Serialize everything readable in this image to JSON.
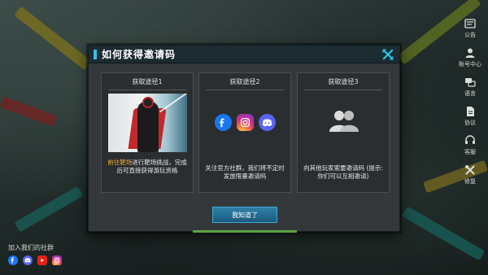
{
  "dialog": {
    "title": "如何获得邀请码",
    "ok_label": "我知道了",
    "cards": [
      {
        "title": "获取途径1",
        "highlight": "前往靶场",
        "text": "进行靶场挑战，完成后可直接获得游玩资格"
      },
      {
        "title": "获取途径2",
        "text": "关注官方社群，我们将不定时发放限量邀请码",
        "icons": [
          "facebook-icon",
          "instagram-icon",
          "discord-icon"
        ]
      },
      {
        "title": "获取途径3",
        "text": "向其他玩家索要邀请码 (提示:你们可以互相邀请)"
      }
    ]
  },
  "side_menu": [
    {
      "label": "公告",
      "icon": "announcement-icon"
    },
    {
      "label": "账号中心",
      "icon": "account-icon"
    },
    {
      "label": "语言",
      "icon": "language-icon"
    },
    {
      "label": "协议",
      "icon": "agreement-icon"
    },
    {
      "label": "客服",
      "icon": "customer-service-icon"
    },
    {
      "label": "修复",
      "icon": "repair-icon"
    }
  ],
  "community": {
    "title": "加入我们的社群",
    "icons": [
      "facebook-icon",
      "discord-icon",
      "youtube-icon",
      "instagram-icon"
    ]
  },
  "colors": {
    "accent": "#2ec4e6",
    "highlight": "#f0a830",
    "button": "#1b5a7c"
  }
}
